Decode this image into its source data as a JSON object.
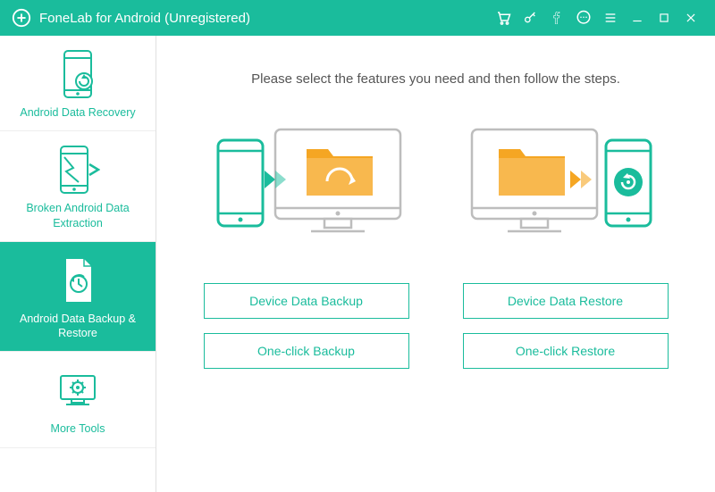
{
  "titlebar": {
    "title": "FoneLab for Android (Unregistered)"
  },
  "sidebar": {
    "items": [
      {
        "label": "Android Data Recovery"
      },
      {
        "label": "Broken Android Data Extraction"
      },
      {
        "label": "Android Data Backup & Restore"
      },
      {
        "label": "More Tools"
      }
    ]
  },
  "main": {
    "instruction": "Please select the features you need and then follow the steps.",
    "buttons": {
      "device_backup": "Device Data Backup",
      "device_restore": "Device Data Restore",
      "oneclick_backup": "One-click Backup",
      "oneclick_restore": "One-click Restore"
    }
  },
  "colors": {
    "accent": "#1abc9c",
    "folder": "#f5a623"
  }
}
